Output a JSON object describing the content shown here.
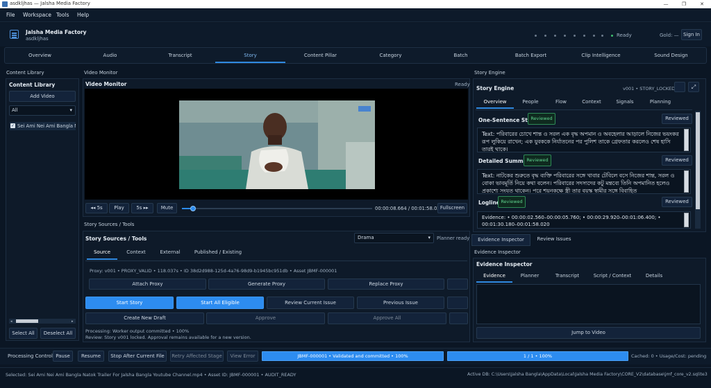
{
  "window": {
    "title": "asdkljhas — Jalsha Media Factory"
  },
  "menu": [
    "File",
    "Workspace",
    "Tools",
    "Help"
  ],
  "header": {
    "app_name": "Jalsha Media Factory",
    "project": "asdkljhas",
    "status": "Ready",
    "gold": "Gold: —",
    "sign_in": "Sign In"
  },
  "tabs": [
    "Overview",
    "Audio",
    "Transcript",
    "Story",
    "Content Pillar",
    "Category",
    "Batch",
    "Batch Export",
    "Clip Intelligence",
    "Sound Design"
  ],
  "active_tab": "Story",
  "library": {
    "section": "Content Library",
    "title": "Content Library",
    "add": "Add Video",
    "filter": "All",
    "items": [
      "Sei Ami Nei Ami Bangla Nat"
    ],
    "select_all": "Select All",
    "deselect_all": "Deselect All"
  },
  "monitor": {
    "section": "Video Monitor",
    "title": "Video Monitor",
    "status": "Ready",
    "back": "◂◂ 5s",
    "play": "Play",
    "fwd": "5s ▸▸",
    "mute": "Mute",
    "time": "00:00:08.664 / 00:01:58.020",
    "fullscreen": "Fullscreen",
    "progress": 0.06
  },
  "sources": {
    "section": "Story Sources / Tools",
    "title": "Story Sources / Tools",
    "genre": "Drama",
    "planner": "Planner ready • ",
    "tabs": [
      "Source",
      "Context",
      "External",
      "Published / Existing"
    ],
    "active": "Source",
    "proxy_info": "Proxy: v001 • PROXY_VALID • 118.037s • ID 38d2d988-125d-4a76-98d9-b1945bc951db • Asset JBMF-000001",
    "buttons_row1": [
      "Attach Proxy",
      "Generate Proxy",
      "Replace Proxy"
    ],
    "buttons_row2": [
      "Start Story",
      "Start All Eligible",
      "Review Current Issue",
      "Previous Issue"
    ],
    "buttons_row3": [
      "Create New Draft",
      "Approve",
      "Approve All"
    ],
    "processing": "Processing: Worker output committed • 100%",
    "review": "Review: Story v001 locked. Approval remains available for a new version."
  },
  "engine": {
    "section": "Story Engine",
    "title": "Story Engine",
    "version": "v001 • STORY_LOCKED",
    "tabs": [
      "Overview",
      "People",
      "Flow",
      "Context",
      "Signals",
      "Planning"
    ],
    "active": "Overview",
    "one_sentence": {
      "label": "One-Sentence Story",
      "tag": "Reviewed",
      "btn": "Reviewed",
      "text": "Text: পরিবারের চোখে শান্ত ও সরল এক বৃদ্ধ অপমান ও অবহেলার আড়ালে নিজের ভয়ংকর রূপ লুকিয়ে রাখেন; এক যুবককে নির্যাতনের পর পুলিশ তাকে গ্রেফতার করলেও শেষ হাসি তারই থাকে।"
    },
    "summary": {
      "label": "Detailed Summary",
      "tag": "Reviewed",
      "btn": "Reviewed",
      "text": "Text: নাটকের শুরুতে বৃদ্ধ ব্যক্তি পরিবারের সঙ্গে খাবার টেবিলে বসে নিজের শান্ত, সরল ও বোকা ভাবমূর্তি নিয়ে কথা বলেন। পরিবারের সদস্যদের কটু মন্তব্যে তিনি অপমানিত হলেও প্রকাশ্যে সংযত থাকেন। পরে শয়নকক্ষে স্ত্রী তার বয়স্ক স্বামীর সঙ্গে বিবাহিত"
    },
    "logline": {
      "label": "Logline",
      "tag": "Reviewed",
      "btn": "Reviewed",
      "text": "Evidence: • 00:00:02.560–00:00:05.760; • 00:00:29.920–00:01:06.400; • 00:01:30.180–00:01:58.020"
    }
  },
  "inspector": {
    "tabs": [
      "Evidence Inspector",
      "Review Issues"
    ],
    "section": "Evidence Inspector",
    "title": "Evidence Inspector",
    "subtabs": [
      "Evidence",
      "Planner",
      "Transcript",
      "Script / Context",
      "Details"
    ],
    "active": "Evidence",
    "jump": "Jump to Video"
  },
  "processing": {
    "label": "Processing Control",
    "pause": "Pause",
    "resume": "Resume",
    "stop": "Stop After Current File",
    "retry": "Retry Affected Stage",
    "view_error": "View Error",
    "bar1": "JBMF-000001 • Validated and committed • 100%",
    "bar2": "1 / 1 • 100%",
    "cached": "Cached: 0 • Usage/Cost: pending"
  },
  "status": {
    "left": "Selected: Sei Ami Nei Ami Bangla Natok Trailer For Jalsha Bangla Youtube Channel.mp4 • Asset ID: JBMF-000001 • AUDIT_READY",
    "right": "Active DB: C:\\Users\\Jalsha Bangla\\AppData\\Local\\Jalsha Media Factory\\CORE_V2\\database\\jmf_core_v2.sqlite3"
  },
  "colors": {
    "accent": "#2d8cf0",
    "bg": "#0b1624",
    "reviewed": "#5fd38f"
  }
}
